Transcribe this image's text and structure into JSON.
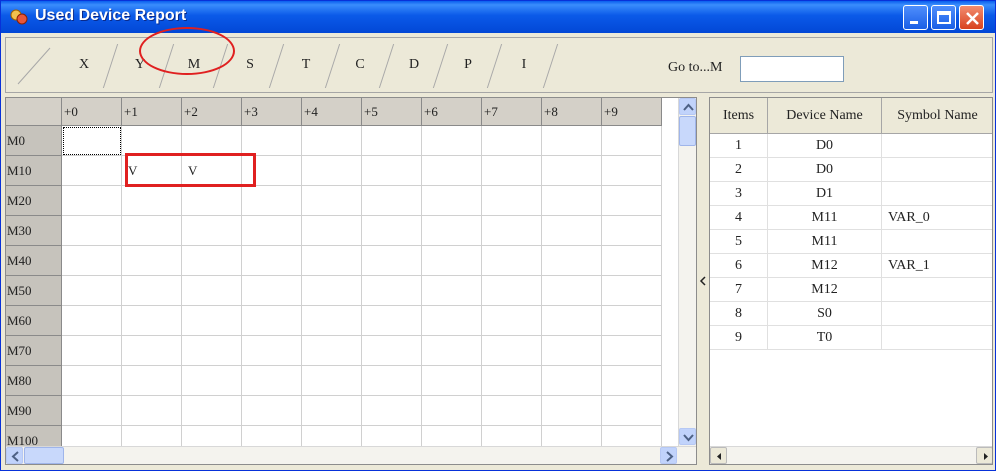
{
  "window": {
    "title": "Used Device Report"
  },
  "tabs": [
    "X",
    "Y",
    "M",
    "S",
    "T",
    "C",
    "D",
    "P",
    "I"
  ],
  "goto": {
    "label": "Go to...M",
    "value": ""
  },
  "grid": {
    "columns": [
      "+0",
      "+1",
      "+2",
      "+3",
      "+4",
      "+5",
      "+6",
      "+7",
      "+8",
      "+9"
    ],
    "rows": [
      {
        "label": "M0",
        "cells": [
          "",
          "",
          "",
          "",
          "",
          "",
          "",
          "",
          "",
          ""
        ]
      },
      {
        "label": "M10",
        "cells": [
          "",
          "V",
          "V",
          "",
          "",
          "",
          "",
          "",
          "",
          ""
        ]
      },
      {
        "label": "M20",
        "cells": [
          "",
          "",
          "",
          "",
          "",
          "",
          "",
          "",
          "",
          ""
        ]
      },
      {
        "label": "M30",
        "cells": [
          "",
          "",
          "",
          "",
          "",
          "",
          "",
          "",
          "",
          ""
        ]
      },
      {
        "label": "M40",
        "cells": [
          "",
          "",
          "",
          "",
          "",
          "",
          "",
          "",
          "",
          ""
        ]
      },
      {
        "label": "M50",
        "cells": [
          "",
          "",
          "",
          "",
          "",
          "",
          "",
          "",
          "",
          ""
        ]
      },
      {
        "label": "M60",
        "cells": [
          "",
          "",
          "",
          "",
          "",
          "",
          "",
          "",
          "",
          ""
        ]
      },
      {
        "label": "M70",
        "cells": [
          "",
          "",
          "",
          "",
          "",
          "",
          "",
          "",
          "",
          ""
        ]
      },
      {
        "label": "M80",
        "cells": [
          "",
          "",
          "",
          "",
          "",
          "",
          "",
          "",
          "",
          ""
        ]
      },
      {
        "label": "M90",
        "cells": [
          "",
          "",
          "",
          "",
          "",
          "",
          "",
          "",
          "",
          ""
        ]
      },
      {
        "label": "M100",
        "cells": [
          "",
          "",
          "",
          "",
          "",
          "",
          "",
          "",
          "",
          ""
        ]
      }
    ]
  },
  "items_table": {
    "headers": [
      "Items",
      "Device Name",
      "Symbol Name"
    ],
    "rows": [
      {
        "item": "1",
        "device": "D0",
        "symbol": ""
      },
      {
        "item": "2",
        "device": "D0",
        "symbol": ""
      },
      {
        "item": "3",
        "device": "D1",
        "symbol": ""
      },
      {
        "item": "4",
        "device": "M11",
        "symbol": "VAR_0"
      },
      {
        "item": "5",
        "device": "M11",
        "symbol": ""
      },
      {
        "item": "6",
        "device": "M12",
        "symbol": "VAR_1"
      },
      {
        "item": "7",
        "device": "M12",
        "symbol": ""
      },
      {
        "item": "8",
        "device": "S0",
        "symbol": ""
      },
      {
        "item": "9",
        "device": "T0",
        "symbol": ""
      }
    ]
  },
  "colors": {
    "titlebar": "#0b5ae8",
    "highlight": "#e02020",
    "header_gray": "#d4d0c8"
  },
  "icons": [
    "app-icon",
    "minimize-icon",
    "maximize-icon",
    "close-icon",
    "scroll-up-icon",
    "scroll-down-icon",
    "scroll-left-icon",
    "scroll-right-icon",
    "collapse-arrow-icon"
  ]
}
